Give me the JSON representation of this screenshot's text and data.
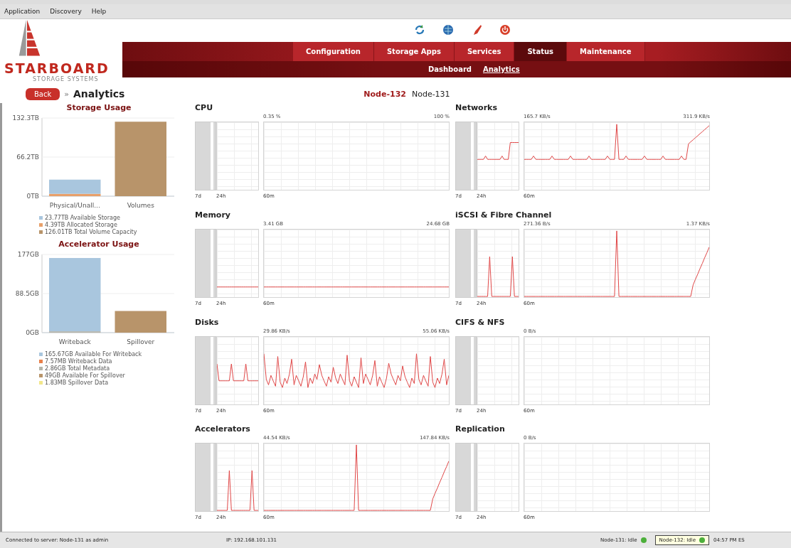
{
  "menu": [
    "Application",
    "Discovery",
    "Help"
  ],
  "logo": {
    "name": "STARBOARD",
    "tagline": "STORAGE SYSTEMS"
  },
  "nav": [
    {
      "label": "Configuration",
      "selected": false
    },
    {
      "label": "Storage Apps",
      "selected": false
    },
    {
      "label": "Services",
      "selected": false
    },
    {
      "label": "Status",
      "selected": true
    },
    {
      "label": "Maintenance",
      "selected": false
    }
  ],
  "subnav": [
    {
      "label": "Dashboard",
      "selected": false
    },
    {
      "label": "Analytics",
      "selected": true
    }
  ],
  "breadcrumb": {
    "back": "Back",
    "separator": "»",
    "title": "Analytics"
  },
  "nodes": [
    {
      "label": "Node-132",
      "selected": true
    },
    {
      "label": "Node-131",
      "selected": false
    }
  ],
  "sidebar": {
    "storage": {
      "chart_data": {
        "type": "bar",
        "title": "Storage Usage",
        "categories": [
          "Physical/Unall...",
          "Volumes"
        ],
        "stacked": true,
        "ylim": [
          0,
          132.3
        ],
        "yticks": [
          {
            "value": 0,
            "label": "0TB"
          },
          {
            "value": 66.2,
            "label": "66.2TB"
          },
          {
            "value": 132.3,
            "label": "132.3TB"
          }
        ],
        "series": [
          {
            "name": "23.77TB Available Storage",
            "color": "#a9c6de",
            "values": [
              24,
              null
            ]
          },
          {
            "name": "4.39TB Allocated Storage",
            "color": "#e8a06a",
            "values": [
              4,
              null
            ]
          },
          {
            "name": "126.01TB Total Volume Capacity",
            "color": "#b8946a",
            "values": [
              null,
              126
            ]
          }
        ]
      }
    },
    "accelerator": {
      "chart_data": {
        "type": "bar",
        "title": "Accelerator Usage",
        "categories": [
          "Writeback",
          "Spillover"
        ],
        "stacked": true,
        "ylim": [
          0,
          177
        ],
        "yticks": [
          {
            "value": 0,
            "label": "0GB"
          },
          {
            "value": 88.5,
            "label": "88.5GB"
          },
          {
            "value": 177,
            "label": "177GB"
          }
        ],
        "series": [
          {
            "name": "165.67GB Available For Writeback",
            "color": "#a9c6de",
            "values": [
              166,
              null
            ]
          },
          {
            "name": "7.57MB Writeback Data",
            "color": "#e8804a",
            "values": [
              0,
              null
            ]
          },
          {
            "name": "2.86GB Total Metadata",
            "color": "#b4b4a8",
            "values": [
              3,
              null
            ]
          },
          {
            "name": "49GB Available For Spillover",
            "color": "#b8946a",
            "values": [
              null,
              49
            ]
          },
          {
            "name": "1.83MB Spillover Data",
            "color": "#f2e68a",
            "values": [
              null,
              0
            ]
          }
        ]
      }
    }
  },
  "graphs": [
    {
      "title": "CPU",
      "low": "0.35 %",
      "high": "100 %",
      "spans": [
        "7d",
        "24h",
        "60m"
      ],
      "kind": "none"
    },
    {
      "title": "Networks",
      "low": "165.7 KB/s",
      "high": "311.9 KB/s",
      "spans": [
        "7d",
        "24h",
        "60m"
      ],
      "kind": "periodic"
    },
    {
      "title": "Memory",
      "low": "3.41 GB",
      "high": "24.68 GB",
      "spans": [
        "7d",
        "24h",
        "60m"
      ],
      "kind": "flat"
    },
    {
      "title": "iSCSI & Fibre Channel",
      "low": "271.36 B/s",
      "high": "1.37 KB/s",
      "spans": [
        "7d",
        "24h",
        "60m"
      ],
      "kind": "bursty"
    },
    {
      "title": "Disks",
      "low": "29.86 KB/s",
      "high": "55.06 KB/s",
      "spans": [
        "7d",
        "24h",
        "60m"
      ],
      "kind": "busy"
    },
    {
      "title": "CIFS & NFS",
      "low": "0 B/s",
      "spans": [
        "7d",
        "24h",
        "60m"
      ],
      "kind": "none"
    },
    {
      "title": "Accelerators",
      "low": "44.54 KB/s",
      "high": "147.84 KB/s",
      "spans": [
        "7d",
        "24h",
        "60m"
      ],
      "kind": "bursty"
    },
    {
      "title": "Replication",
      "low": "0 B/s",
      "spans": [
        "7d",
        "24h",
        "60m"
      ],
      "kind": "none"
    }
  ],
  "status_bar": {
    "connection": "Connected to server: Node-131 as admin",
    "ip": "IP: 192.168.101.131",
    "nodes": [
      {
        "label": "Node-131: Idle",
        "color": "#4caf3a",
        "selected": false
      },
      {
        "label": "Node-132: Idle",
        "color": "#4caf3a",
        "selected": true
      }
    ],
    "time": "04:57 PM ES"
  }
}
